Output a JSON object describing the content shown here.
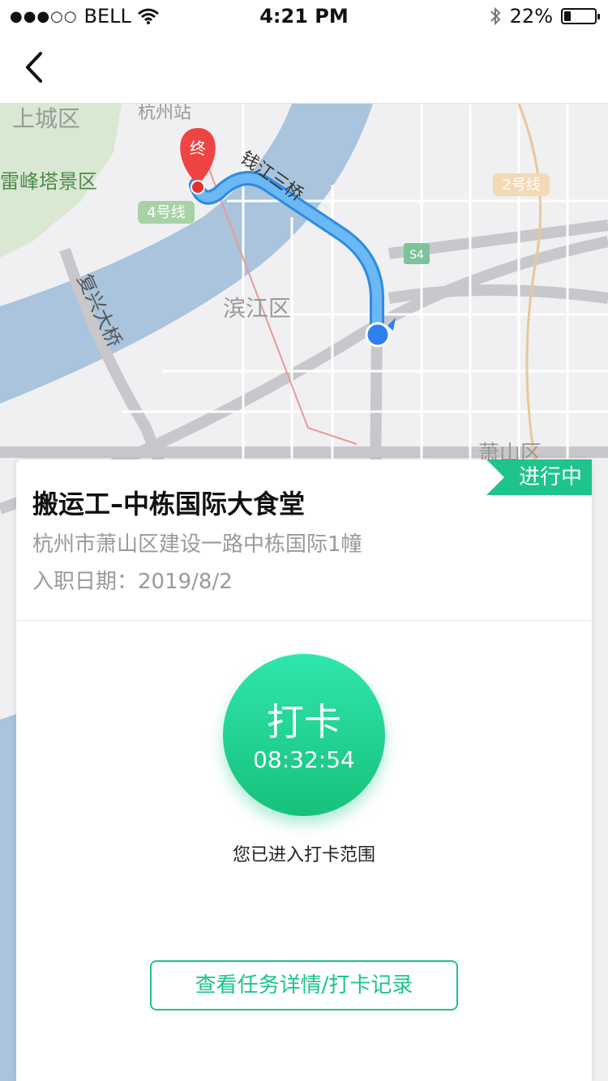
{
  "status_bar": {
    "signal_dots": "●●●○○",
    "carrier": "BELL",
    "time": "4:21 PM",
    "battery_percent": "22%",
    "battery_level": 0.22
  },
  "nav": {
    "back_icon": "chevron-left-icon"
  },
  "map": {
    "labels": {
      "shangcheng": "上城区",
      "hangzhou_station": "杭州站",
      "leifeng": "雷峰塔景区",
      "qianjiang_bridge": "钱江三桥",
      "line2": "2号线",
      "line4": "4号线",
      "s4": "S4",
      "fuxing_bridge": "复兴大桥",
      "binjiang": "滨江区",
      "xiaoshan": "萧山区",
      "end_marker": "终"
    },
    "colors": {
      "water": "#a9c4dc",
      "route": "#4aa8f0",
      "end_marker": "#f04444",
      "current_location": "#2f7ff0"
    }
  },
  "card": {
    "status_tag": "进行中",
    "job_title": "搬运工–中栋国际大食堂",
    "address": "杭州市萧山区建设一路中栋国际1幢",
    "hire_date": "入职日期：2019/8/2",
    "clock_button": {
      "label": "打卡",
      "time": "08:32:54"
    },
    "range_status": "您已进入打卡范围",
    "detail_button": "查看任务详情/打卡记录",
    "accent_color": "#1ec48a"
  }
}
